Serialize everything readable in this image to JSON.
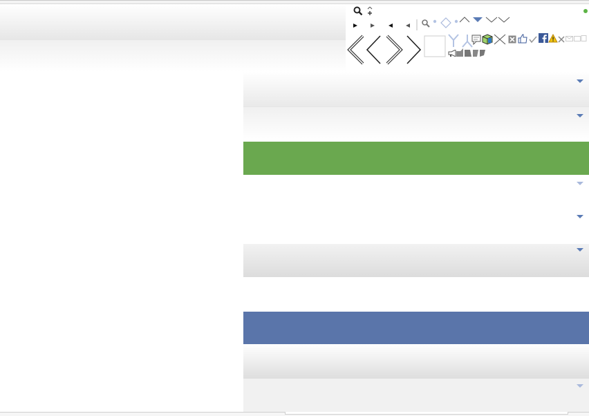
{
  "window": {
    "title": ""
  },
  "sprite": {
    "icons": [
      "search-icon",
      "move-icon",
      "status-dot-icon",
      "play-right-icon",
      "play-right-light-icon",
      "play-left-icon",
      "play-left-light-icon",
      "search-small-icon",
      "diamond-icon",
      "chevron-up-icon",
      "triangle-down-icon",
      "chevron-down-icon",
      "chevron-double-left-icon",
      "chevron-left-icon",
      "chevron-right-icon",
      "chevron-double-right-icon",
      "blank-square-icon",
      "comment-icon",
      "cube-icon",
      "close-x-icon",
      "thumbs-up-icon",
      "checkmark-icon",
      "facebook-icon",
      "warning-icon",
      "x-icon",
      "envelope-icon",
      "megaphone-icon"
    ],
    "colors": {
      "blue": "#5a7bb5",
      "green": "#6aa84f",
      "facebook": "#3b5998",
      "warning": "#f1c40f"
    }
  },
  "panels": {
    "colors": {
      "green": "#6aa84f",
      "blue": "#5a75aa",
      "grey": "#dddddd"
    }
  }
}
